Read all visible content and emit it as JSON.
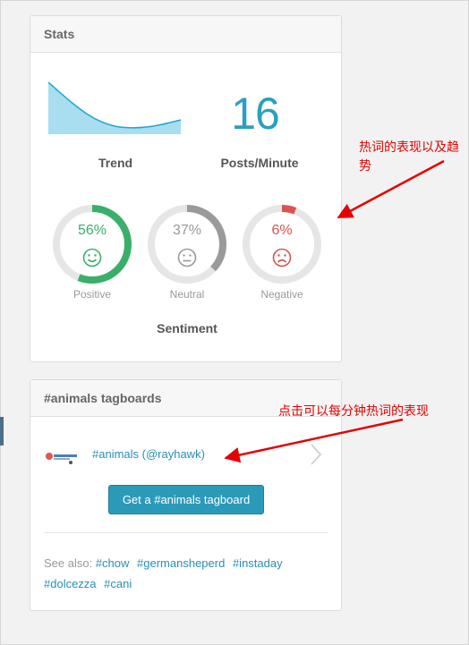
{
  "stats": {
    "title": "Stats",
    "trend_label": "Trend",
    "posts_per_minute": "16",
    "posts_per_minute_label": "Posts/Minute",
    "sentiment_label": "Sentiment",
    "positive": {
      "value": 56,
      "text": "56%",
      "label": "Positive",
      "color": "#3aaf6a",
      "icon": "smile-face-icon"
    },
    "neutral": {
      "value": 37,
      "text": "37%",
      "label": "Neutral",
      "color": "#9a9a9a",
      "icon": "neutral-face-icon"
    },
    "negative": {
      "value": 6,
      "text": "6%",
      "label": "Negative",
      "color": "#d9534f",
      "icon": "frown-face-icon"
    }
  },
  "tagboards": {
    "title": "#animals tagboards",
    "item_link": "#animals (@rayhawk)",
    "button_label": "Get a #animals tagboard",
    "see_also_label": "See also:",
    "see_also_tags": [
      "#chow",
      "#germansheperd",
      "#instaday",
      "#dolcezza",
      "#cani"
    ]
  },
  "annotations": {
    "note1": "热词的表现以及趋势",
    "note2": "点击可以每分钟热词的表现"
  },
  "colors": {
    "accent": "#2a9ab8",
    "trend_fill": "#a8def0",
    "trend_stroke": "#1fa6cf",
    "annotation": "#e60000"
  }
}
